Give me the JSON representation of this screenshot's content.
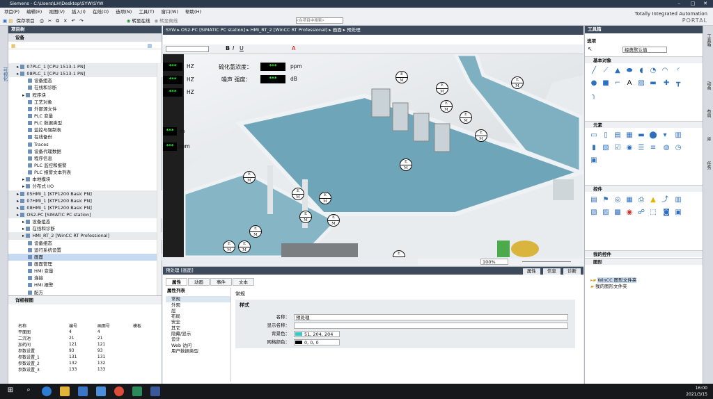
{
  "window": {
    "title": "Siemens - C:\\Users\\LH\\Desktop\\SYW\\SYW",
    "min": "–",
    "max": "□",
    "close": "✕"
  },
  "menu": [
    "项目(P)",
    "编辑(E)",
    "视图(V)",
    "插入(I)",
    "在线(O)",
    "选项(N)",
    "工具(T)",
    "窗口(W)",
    "帮助(H)"
  ],
  "toolbar": {
    "save": "保存项目",
    "online": "转至在线",
    "offline": "转至离线",
    "search_placeholder": "<在项目中搜索>"
  },
  "brand": {
    "line1": "Totally Integrated Automation",
    "line2": "PORTAL"
  },
  "leftstrip": {
    "label": "可视化"
  },
  "project_tree": {
    "title": "项目树",
    "tab": "设备",
    "rows": [
      {
        "t": "07PLC_1 [CPU 1513-1 PN]",
        "i": 1,
        "g": true
      },
      {
        "t": "08PLC_1 [CPU 1513-1 PN]",
        "i": 1,
        "g": true
      },
      {
        "t": "设备组态",
        "i": 3
      },
      {
        "t": "在线和诊断",
        "i": 3
      },
      {
        "t": "程序块",
        "i": 2
      },
      {
        "t": "工艺对象",
        "i": 3
      },
      {
        "t": "外部源文件",
        "i": 3
      },
      {
        "t": "PLC 变量",
        "i": 3
      },
      {
        "t": "PLC 数据类型",
        "i": 3
      },
      {
        "t": "监控与强制表",
        "i": 3
      },
      {
        "t": "在线备份",
        "i": 3
      },
      {
        "t": "Traces",
        "i": 3
      },
      {
        "t": "设备代理数据",
        "i": 3
      },
      {
        "t": "程序信息",
        "i": 3
      },
      {
        "t": "PLC 监控和报警",
        "i": 3
      },
      {
        "t": "PLC 报警文本列表",
        "i": 3
      },
      {
        "t": "本地模块",
        "i": 2
      },
      {
        "t": "分布式 I/O",
        "i": 2
      },
      {
        "t": "05HMI_1 [KTP1200 Basic PN]",
        "i": 1,
        "g": true
      },
      {
        "t": "07HMI_1 [KTP1200 Basic PN]",
        "i": 1,
        "g": true
      },
      {
        "t": "08HMI_1 [KTP1200 Basic PN]",
        "i": 1,
        "g": true
      },
      {
        "t": "OS2-PC [SIMATIC PC station]",
        "i": 1,
        "g": true
      },
      {
        "t": "设备组态",
        "i": 2
      },
      {
        "t": "在线和诊断",
        "i": 2
      },
      {
        "t": "HMI_RT_2 [WinCC RT Professional]",
        "i": 2,
        "g": true
      },
      {
        "t": "设备组态",
        "i": 3
      },
      {
        "t": "运行系统设置",
        "i": 3
      },
      {
        "t": "画面",
        "i": 3,
        "s": true
      },
      {
        "t": "画面管理",
        "i": 3
      },
      {
        "t": "HMI 变量",
        "i": 3
      },
      {
        "t": "连接",
        "i": 3
      },
      {
        "t": "HMI 报警",
        "i": 3
      },
      {
        "t": "配方",
        "i": 3
      }
    ]
  },
  "detail_view": {
    "title": "详细视图",
    "headers": [
      "名称",
      "编号",
      "画面号",
      "模板"
    ],
    "rows": [
      [
        "平面图",
        "4",
        "4",
        ""
      ],
      [
        "二沉池",
        "21",
        "21",
        ""
      ],
      [
        "加药间",
        "121",
        "121",
        ""
      ],
      [
        "参数设置",
        "93",
        "93",
        ""
      ],
      [
        "参数设置_1",
        "131",
        "131",
        ""
      ],
      [
        "参数设置_2",
        "132",
        "132",
        ""
      ],
      [
        "参数设置_3",
        "133",
        "133",
        ""
      ]
    ]
  },
  "editor": {
    "breadcrumb": "SYW ▸ OS2-PC [SIMATIC PC station] ▸ HMI_RT_2 [WinCC RT Professional] ▸ 画面 ▸ 预处理",
    "labels": {
      "sulfide": "硫化氢浓度：",
      "noise": "噪声 强度："
    },
    "units": {
      "hz": "HZ",
      "ppm": "ppm",
      "db": "dB",
      "m": "m"
    },
    "display": "***",
    "monitor_top": "E",
    "monitor_bottom": "M"
  },
  "zoom": {
    "value": "100%"
  },
  "properties": {
    "title": "预处理 [画面]",
    "tabs": [
      "属性",
      "动画",
      "事件",
      "文本"
    ],
    "top_tabs": [
      "属性",
      "信息",
      "诊断"
    ],
    "list_title": "属性列表",
    "list": [
      "常规",
      "外观",
      "层",
      "布局",
      "安全",
      "其它",
      "隐藏/显示",
      "设计",
      "Web 访问",
      "用户数据类型"
    ],
    "section": "常规",
    "group": "样式",
    "fields": {
      "name_label": "名称：",
      "name": "预处理",
      "display_label": "显示名称：",
      "display": "",
      "bg_label": "背景色：",
      "bg": "51, 204, 204",
      "grid_label": "网格颜色：",
      "grid": "0, 0, 0"
    },
    "colors": {
      "bg": "#33cccc",
      "grid": "#000000"
    }
  },
  "toolbox": {
    "title": "工具箱",
    "options": "选项",
    "style": "经典默认值",
    "sections": {
      "basic": "基本对象",
      "elements": "元素",
      "controls": "控件",
      "my_controls": "我的控件",
      "graphics": "图形"
    },
    "graphics_tree": [
      "WinCC 图形文件夹",
      "我的图形文件夹"
    ]
  },
  "right_tabs": [
    "工具箱",
    "动画",
    "布局",
    "库",
    "任务"
  ],
  "clock": {
    "time": "16:00",
    "date": "2021/3/15"
  }
}
